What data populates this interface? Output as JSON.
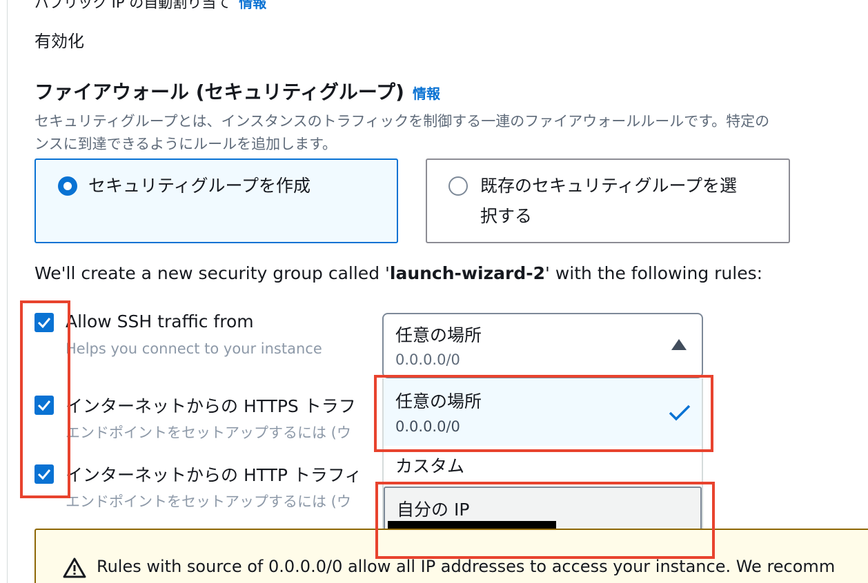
{
  "public_ip": {
    "label": "パブリック IP の自動割り当て",
    "info": "情報",
    "value": "有効化"
  },
  "firewall": {
    "heading": "ファイアウォール (セキュリティグループ)",
    "info": "情報",
    "description_line1": "セキュリティグループとは、インスタンスのトラフィックを制御する一連のファイアウォールルールです。特定の",
    "description_line2": "ンスに到達できるようにルールを追加します。",
    "options": [
      {
        "label": "セキュリティグループを作成",
        "selected": true
      },
      {
        "label_line1": "既存のセキュリティグループを選",
        "label_line2": "択する",
        "selected": false
      }
    ]
  },
  "rules_intro": {
    "prefix": "We'll create a new security group called '",
    "group_name": "launch-wizard-2",
    "suffix": "' with the following rules:"
  },
  "rules": [
    {
      "label": "Allow SSH traffic from",
      "description": "Helps you connect to your instance",
      "checked": true
    },
    {
      "label": "インターネットからの HTTPS トラフ",
      "description": "エンドポイントをセットアップするには (ウ",
      "checked": true
    },
    {
      "label": "インターネットからの HTTP トラフィ",
      "description": "エンドポイントをセットアップするには (ウ",
      "checked": true
    }
  ],
  "ssh_source_select": {
    "selected_label": "任意の場所",
    "selected_value": "0.0.0.0/0",
    "expanded": true,
    "options": [
      {
        "label": "任意の場所",
        "value": "0.0.0.0/0",
        "selected": true
      },
      {
        "label": "カスタム"
      },
      {
        "label": "自分の IP",
        "value_redacted": true
      }
    ]
  },
  "alert": {
    "type": "warning",
    "text": "Rules with source of 0.0.0.0/0 allow all IP addresses to access your instance. We recomm"
  },
  "colors": {
    "accent": "#0972d3",
    "annotation_red": "#e8432e",
    "warning_bg": "#fffce9",
    "warning_border": "#8d6605"
  }
}
